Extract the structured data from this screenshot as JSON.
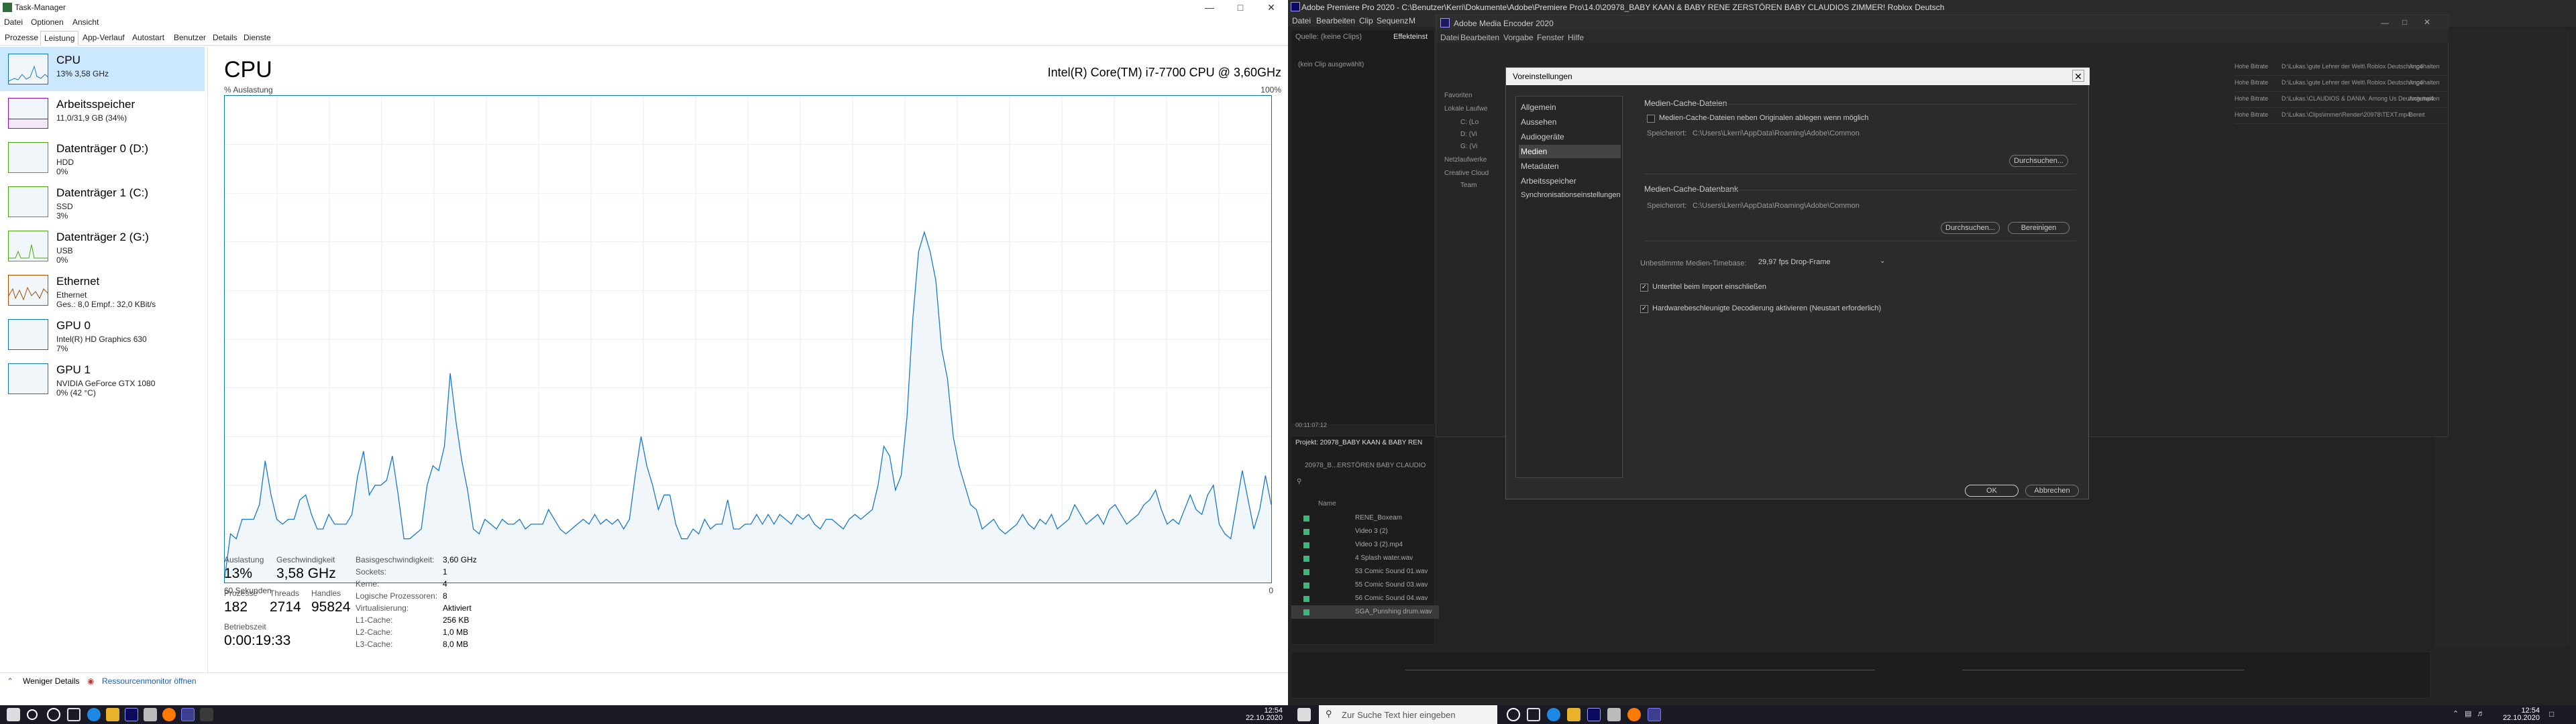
{
  "task_manager": {
    "title": "Task-Manager",
    "menu": [
      "Datei",
      "Optionen",
      "Ansicht"
    ],
    "tabs": [
      "Prozesse",
      "Leistung",
      "App-Verlauf",
      "Autostart",
      "Benutzer",
      "Details",
      "Dienste"
    ],
    "active_tab": "Leistung",
    "sidebar": [
      {
        "title": "CPU",
        "line1": "13% 3,58 GHz",
        "line2": ""
      },
      {
        "title": "Arbeitsspeicher",
        "line1": "11,0/31,9 GB (34%)",
        "line2": ""
      },
      {
        "title": "Datenträger 0 (D:)",
        "line1": "HDD",
        "line2": "0%"
      },
      {
        "title": "Datenträger 1 (C:)",
        "line1": "SSD",
        "line2": "3%"
      },
      {
        "title": "Datenträger 2 (G:)",
        "line1": "USB",
        "line2": "0%"
      },
      {
        "title": "Ethernet",
        "line1": "Ethernet",
        "line2": "Ges.: 8,0 Empf.: 32,0 KBit/s"
      },
      {
        "title": "GPU 0",
        "line1": "Intel(R) HD Graphics 630",
        "line2": "7%"
      },
      {
        "title": "GPU 1",
        "line1": "NVIDIA GeForce GTX 1080",
        "line2": "0% (42 °C)"
      }
    ],
    "main": {
      "title": "CPU",
      "cpu_name": "Intel(R) Core(TM) i7-7700 CPU @ 3,60GHz",
      "util_label": "% Auslastung",
      "max_label": "100%",
      "time_label": "60 Sekunden",
      "zero_label": "0"
    },
    "stats": {
      "auslastung_label": "Auslastung",
      "auslastung": "13%",
      "geschw_label": "Geschwindigkeit",
      "geschw": "3,58 GHz",
      "prozesse_label": "Prozesse",
      "prozesse": "182",
      "threads_label": "Threads",
      "threads": "2714",
      "handles_label": "Handles",
      "handles": "95824",
      "betrieb_label": "Betriebszeit",
      "betrieb": "0:00:19:33"
    },
    "details": [
      {
        "k": "Basisgeschwindigkeit:",
        "v": "3,60 GHz"
      },
      {
        "k": "Sockets:",
        "v": "1"
      },
      {
        "k": "Kerne:",
        "v": "4"
      },
      {
        "k": "Logische Prozessoren:",
        "v": "8"
      },
      {
        "k": "Virtualisierung:",
        "v": "Aktiviert"
      },
      {
        "k": "L1-Cache:",
        "v": "256 KB"
      },
      {
        "k": "L2-Cache:",
        "v": "1,0 MB"
      },
      {
        "k": "L3-Cache:",
        "v": "8,0 MB"
      }
    ],
    "footer": {
      "less": "Weniger Details",
      "resmon": "Ressourcenmonitor öffnen"
    },
    "cpu_history": [
      1,
      10,
      9,
      13,
      13,
      13,
      16,
      25,
      18,
      13,
      12,
      13,
      13,
      17,
      18,
      14,
      11,
      11,
      14,
      12,
      12,
      12,
      14,
      22,
      27,
      18,
      20,
      20,
      21,
      26,
      18,
      9,
      9,
      10,
      11,
      20,
      24,
      23,
      28,
      43,
      33,
      25,
      19,
      11,
      10,
      13,
      12,
      11,
      13,
      12,
      12,
      13,
      11,
      12,
      12,
      12,
      15,
      13,
      11,
      10,
      11,
      12,
      13,
      12,
      14,
      12,
      13,
      12,
      13,
      11,
      13,
      22,
      30,
      24,
      20,
      15,
      18,
      18,
      12,
      9,
      9,
      11,
      10,
      13,
      11,
      12,
      12,
      17,
      11,
      11,
      12,
      12,
      14,
      12,
      14,
      12,
      14,
      13,
      12,
      14,
      13,
      14,
      12,
      11,
      13,
      13,
      12,
      11,
      13,
      14,
      13,
      14,
      15,
      20,
      28,
      26,
      19,
      22,
      34,
      54,
      68,
      72,
      68,
      62,
      48,
      42,
      30,
      24,
      20,
      16,
      15,
      11,
      12,
      13,
      11,
      10,
      11,
      12,
      14,
      12,
      11,
      13,
      12,
      14,
      11,
      12,
      13,
      16,
      14,
      12,
      13,
      14,
      12,
      15,
      16,
      14,
      12,
      13,
      14,
      16,
      17,
      19,
      15,
      12,
      13,
      12,
      15,
      18,
      15,
      14,
      18,
      20,
      12,
      10,
      9,
      16,
      23,
      17,
      11,
      15,
      22,
      16
    ]
  },
  "taskbar_left": {
    "time": "12:54",
    "date": "22.10.2020"
  },
  "premiere": {
    "title": "Adobe Premiere Pro 2020 - C:\\Benutzer\\Kerri\\Dokumente\\Adobe\\Premiere Pro\\14.0\\20978_BABY KAAN & BABY RENE ZERSTÖREN BABY CLAUDIOS ZIMMER! Roblox Deutsch",
    "menu": [
      "Datei",
      "Bearbeiten",
      "Clip",
      "Sequenz",
      "M"
    ],
    "source_tab": "Quelle: (keine Clips)",
    "effect_tab": "Effekteinst",
    "no_clip": "(kein Clip ausgewählt)",
    "project_tab": "Projekt: 20978_BABY KAAN & BABY REN",
    "project_path": "20978_B...ERSTÖREN BABY CLAUDIO",
    "name_col": "Name",
    "items": [
      "RENE_Boxeam",
      "Video 3 (2)",
      "Video 3 (2).mp4",
      "4 Splash water.wav",
      "53 Comic Sound 01.wav",
      "55 Comic Sound 03.wav",
      "56 Comic Sound 04.wav",
      "SGA_Punshing drum.wav"
    ],
    "timecode": "00:11:07:12"
  },
  "media_encoder": {
    "title": "Adobe Media Encoder 2020",
    "menu": [
      "Datei",
      "Bearbeiten",
      "Vorgabe",
      "Fenster",
      "Hilfe"
    ],
    "browser": {
      "favorites": "Favoriten",
      "local": "Lokale Laufwe",
      "drives": [
        "C: (Lo",
        "D: (Vi",
        "G: (Vi"
      ],
      "network": "Netzlaufwerke",
      "cloud": "Creative Cloud",
      "team": "Team"
    },
    "queue": [
      {
        "preset": "Hohe Bitrate",
        "path": "D:\\Lukas.\\gute Lehrer der Welt\\ Roblox Deutsch.mp4",
        "status": "Angehalten"
      },
      {
        "preset": "Hohe Bitrate",
        "path": "D:\\Lukas.\\gute Lehrer der Welt\\ Roblox Deutsch.mp4",
        "status": "Angehalten"
      },
      {
        "preset": "Hohe Bitrate",
        "path": "D:\\Lukas.\\CLAUDIOS & DANIA. Among Us Deutsch.mp4",
        "status": "Angehalten"
      },
      {
        "preset": "Hohe Bitrate",
        "path": "D:\\Lukas.\\Clips\\immer\\Render\\20978\\TEXT.mp4",
        "status": "Bereit"
      }
    ]
  },
  "dialog": {
    "title": "Voreinstellungen",
    "nav": [
      "Allgemein",
      "Aussehen",
      "Audiogeräte",
      "Medien",
      "Metadaten",
      "Arbeitsspeicher",
      "Synchronisationseinstellungen"
    ],
    "selected": "Medien",
    "cache_files_header": "Medien-Cache-Dateien",
    "cache_files_checkbox": "Medien-Cache-Dateien neben Originalen ablegen wenn möglich",
    "speicherort_label": "Speicherort:",
    "cache_path": "C:\\Users\\Lkerri\\AppData\\Roaming\\Adobe\\Common",
    "browse": "Durchsuchen...",
    "cache_db_header": "Medien-Cache-Datenbank",
    "db_path": "C:\\Users\\Lkerri\\AppData\\Roaming\\Adobe\\Common",
    "clean": "Bereinigen",
    "timebase_label": "Unbestimmte Medien-Timebase:",
    "timebase_value": "29,97 fps Drop-Frame",
    "xmp_checkbox": "Untertitel beim Import einschließen",
    "hw_checkbox": "Hardwarebeschleunigte Decodierung aktivieren (Neustart erforderlich)",
    "ok": "OK",
    "cancel": "Abbrechen"
  },
  "taskbar_right": {
    "search_placeholder": "Zur Suche Text hier eingeben",
    "time": "12:54",
    "date": "22.10.2020"
  },
  "colors": {
    "graph_line": "#1979ca",
    "graph_fill": "#f1f6fa",
    "selection": "#cce8ff",
    "premiere_green": "#3cb878"
  }
}
